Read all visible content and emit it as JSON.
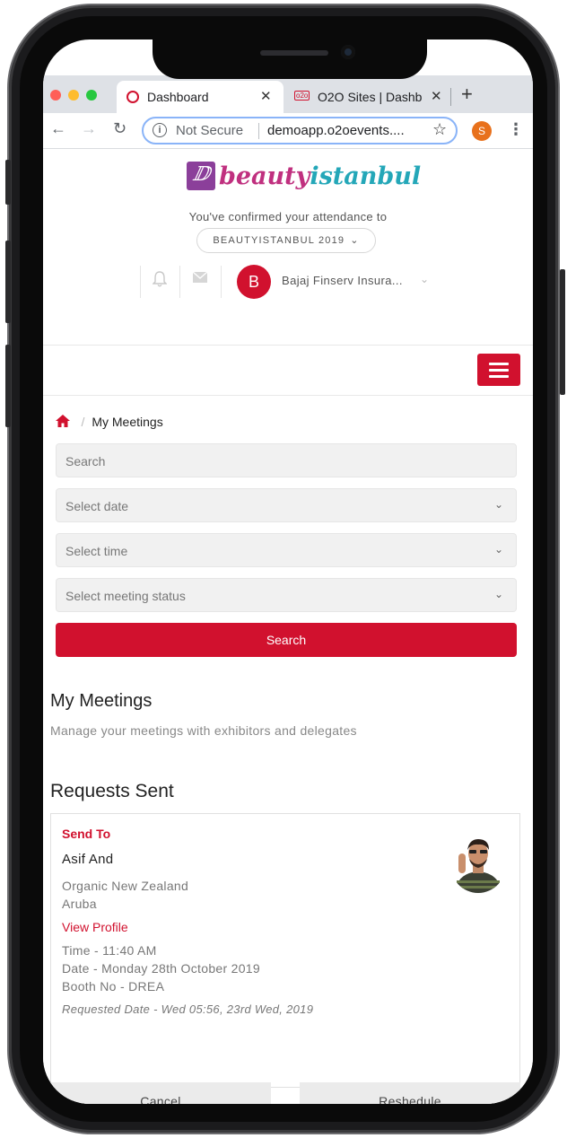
{
  "browser": {
    "tabs": [
      {
        "title": "Dashboard",
        "active": true
      },
      {
        "title": "O2O Sites | Dashb",
        "active": false,
        "favicon_text": "o2o"
      }
    ],
    "address": {
      "security_label": "Not Secure",
      "url": "demoapp.o2oevents...."
    },
    "profile_initial": "S",
    "colors": {
      "close": "#ff5f57",
      "minimize": "#febc2e",
      "zoom": "#28c840",
      "profile": "#e8711c"
    }
  },
  "header": {
    "logo": {
      "part1": "beauty",
      "part2": "istanbul"
    },
    "confirm_text": "You've confirmed your attendance to",
    "event_name": "BEAUTYISTANBUL 2019",
    "user": {
      "initial": "B",
      "name": "Bajaj Finserv Insura..."
    }
  },
  "breadcrumb": {
    "current": "My Meetings"
  },
  "filters": {
    "search_placeholder": "Search",
    "date_placeholder": "Select date",
    "time_placeholder": "Select time",
    "status_placeholder": "Select meeting status",
    "search_button": "Search"
  },
  "main": {
    "title": "My Meetings",
    "subtitle": "Manage your meetings with exhibitors and delegates",
    "section_title": "Requests Sent"
  },
  "request": {
    "send_to_label": "Send To",
    "name": "Asif And",
    "company": "Organic New Zealand",
    "country": "Aruba",
    "view_profile": "View Profile",
    "time": "Time - 11:40 AM",
    "date": "Date - Monday 28th October 2019",
    "booth": "Booth No - DREA",
    "requested_date": "Requested Date - Wed 05:56, 23rd Wed, 2019",
    "cancel_label": "Cancel",
    "reschedule_label": "Reshedule"
  },
  "theme": {
    "accent": "#d1112e"
  }
}
